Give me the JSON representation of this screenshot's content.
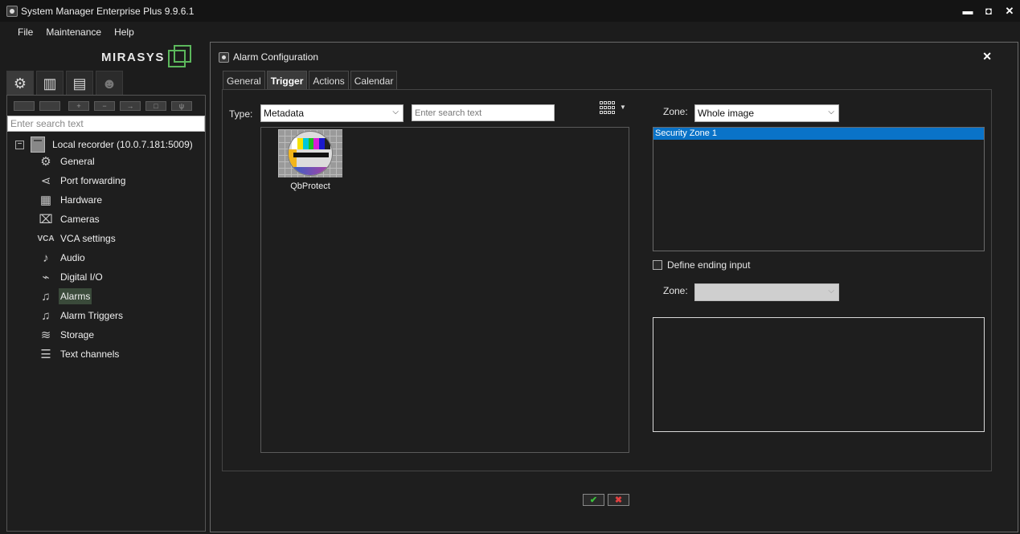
{
  "window": {
    "title": "System Manager Enterprise Plus 9.9.6.1",
    "minimize": "▬",
    "maximize": "◘",
    "close": "✕"
  },
  "menu": [
    "File",
    "Maintenance",
    "Help"
  ],
  "logo": {
    "text": "MIRASYS"
  },
  "left": {
    "search_placeholder": "Enter search text",
    "root_label": "Local recorder (10.0.7.181:5009)",
    "items": [
      {
        "label": "General",
        "icon": "gear-icon"
      },
      {
        "label": "Port forwarding",
        "icon": "share-icon"
      },
      {
        "label": "Hardware",
        "icon": "chip-icon"
      },
      {
        "label": "Cameras",
        "icon": "camera-icon"
      },
      {
        "label": "VCA settings",
        "icon": "vca-icon"
      },
      {
        "label": "Audio",
        "icon": "microphone-icon"
      },
      {
        "label": "Digital I/O",
        "icon": "io-icon"
      },
      {
        "label": "Alarms",
        "icon": "bell-icon",
        "selected": true
      },
      {
        "label": "Alarm Triggers",
        "icon": "bell-plus-icon"
      },
      {
        "label": "Storage",
        "icon": "layers-icon"
      },
      {
        "label": "Text channels",
        "icon": "text-list-icon"
      }
    ]
  },
  "dialog": {
    "title": "Alarm Configuration",
    "tabs": [
      "General",
      "Trigger",
      "Actions",
      "Calendar"
    ],
    "active_tab": "Trigger",
    "type_label": "Type:",
    "type_value": "Metadata",
    "search_placeholder": "Enter search text",
    "metadata_items": [
      {
        "label": "QbProtect"
      }
    ],
    "zone_label": "Zone:",
    "zone_value": "Whole image",
    "zones": [
      "Security Zone 1"
    ],
    "define_ending_label": "Define ending input",
    "define_ending_checked": false,
    "end_zone_label": "Zone:",
    "end_zone_value": "",
    "ok_label": "✔",
    "cancel_label": "✖"
  },
  "colors": {
    "selection": "#0a73c8",
    "accent": "#5cb85c"
  }
}
